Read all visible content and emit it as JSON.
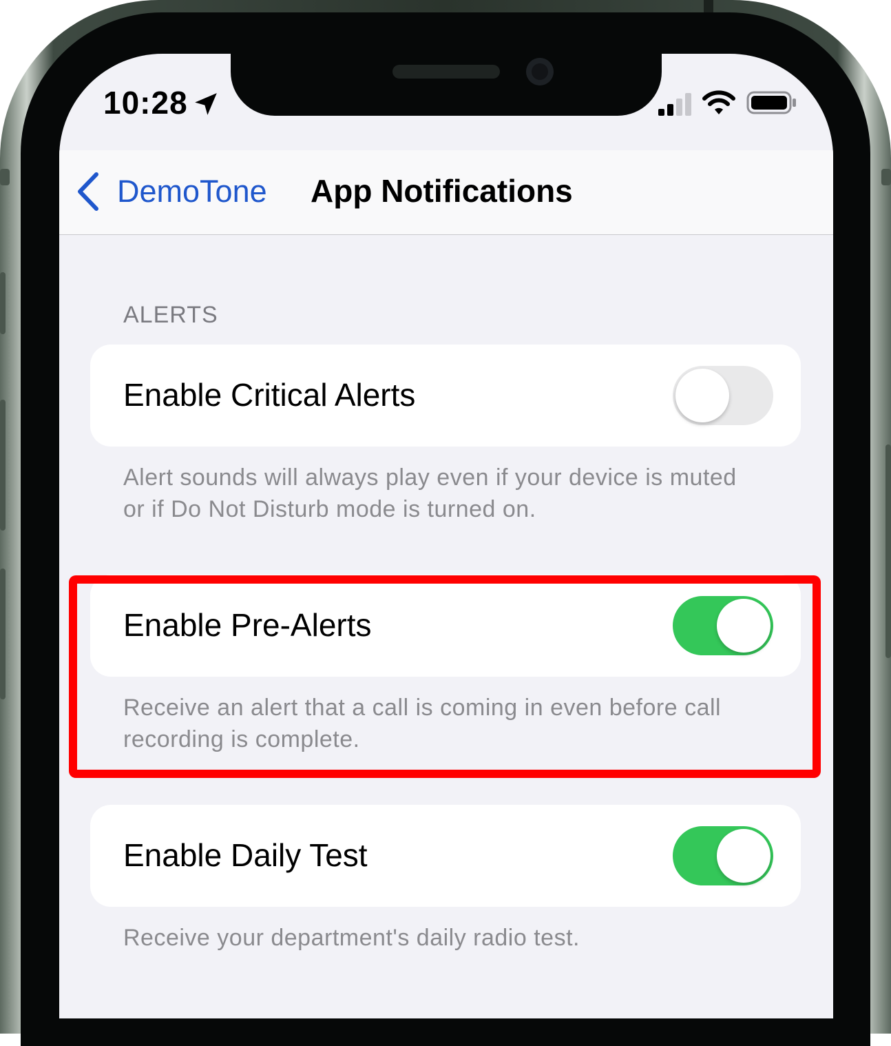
{
  "status_bar": {
    "time": "10:28",
    "icons": [
      "location-arrow-icon",
      "cellular-signal-icon",
      "wifi-icon",
      "battery-icon"
    ]
  },
  "nav": {
    "back_label": "DemoTone",
    "title": "App Notifications"
  },
  "sections": {
    "alerts_header": "ALERTS"
  },
  "settings": [
    {
      "label": "Enable Critical Alerts",
      "enabled": false,
      "footer": "Alert sounds will always play even if your device is muted or if Do Not Disturb mode is turned on."
    },
    {
      "label": "Enable Pre-Alerts",
      "enabled": true,
      "footer": "Receive an alert that a call is coming in even before call recording is complete."
    },
    {
      "label": "Enable Daily Test",
      "enabled": true,
      "footer": "Receive your department's daily radio test."
    }
  ],
  "colors": {
    "accent": "#1f57cc",
    "toggle_on": "#34c759",
    "toggle_off": "#e9e9ea",
    "highlight": "#ff0000",
    "background": "#f2f2f7"
  }
}
